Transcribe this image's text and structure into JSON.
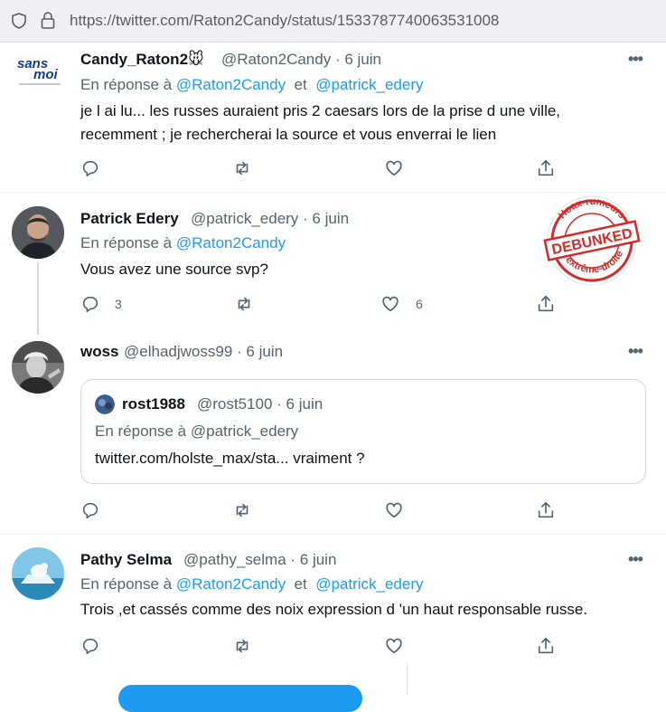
{
  "browser": {
    "url": "https://twitter.com/Raton2Candy/status/1533787740063531008"
  },
  "tweets": [
    {
      "name": "Candy_Raton2",
      "name_emoji": "🐭",
      "handle": "@Raton2Candy",
      "date": "· 6 juin",
      "reply_prefix": "En réponse à",
      "mention1": "@Raton2Candy",
      "conj": "et",
      "mention2": "@patrick_edery",
      "line1": "je l ai lu...  les russes auraient pris 2 caesars lors de la prise d une ville,",
      "line2": "recemment  ;  je rechercherai la source et vous enverrai le lien",
      "avatar_text_1": "sans",
      "avatar_text_2": "moi"
    },
    {
      "name": "Patrick Edery",
      "handle": "@patrick_edery",
      "date": "· 6 juin",
      "reply_prefix": "En réponse à",
      "mention1": "@Raton2Candy",
      "line1": "Vous avez une source svp?",
      "replies": "3",
      "likes": "6"
    },
    {
      "name": "woss",
      "handle": "@elhadjwoss99",
      "date": "· 6 juin",
      "quote": {
        "name": "rost1988",
        "handle": "@rost5100",
        "date": "· 6 juin",
        "reply_prefix": "En réponse à",
        "mention1": "@patrick_edery",
        "text": "twitter.com/holste_max/sta... vraiment ?"
      }
    },
    {
      "name": "Pathy Selma",
      "handle": "@pathy_selma",
      "date": "· 6 juin",
      "reply_prefix": "En réponse à",
      "mention1": "@Raton2Candy",
      "conj": "et",
      "mention2": "@patrick_edery",
      "line1": "Trois ,et cassés comme des noix expression d 'un haut responsable russe."
    }
  ],
  "stamp": {
    "top": "Hoax-rumeurs",
    "middle": "DEBUNKED",
    "bottom": "d'extrême-droite"
  },
  "colors": {
    "accent": "#1d9bf0",
    "secondary_text": "#536471",
    "stamp_red": "#d42a2a"
  }
}
